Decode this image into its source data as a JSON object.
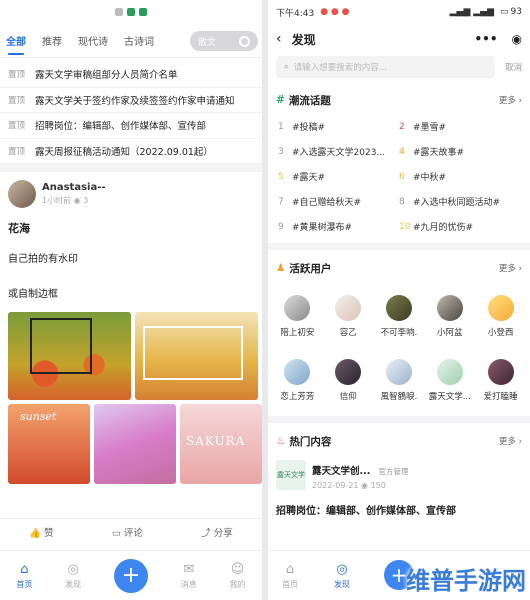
{
  "left": {
    "tabs": [
      "全部",
      "推荐",
      "现代诗",
      "古诗词",
      "散文"
    ],
    "pinned": [
      {
        "tag": "置顶",
        "text": "露天文学审稿组部分人员简介名单"
      },
      {
        "tag": "置顶",
        "text": "露天文学关于签约作家及续签签约作家申请通知"
      },
      {
        "tag": "置顶",
        "text": "招聘岗位：编辑部、创作媒体部、宣传部"
      },
      {
        "tag": "置顶",
        "text": "露天周报征稿活动通知（2022.09.01起）"
      }
    ],
    "post": {
      "author": "Anastasia--",
      "time": "1小时前",
      "views": "3",
      "title": "花海",
      "line1": "自己拍的有水印",
      "line2": "或自制边框",
      "img_text_sunset": "sunset",
      "img_text_sakura": "SAKURA"
    },
    "actions": {
      "like": "赞",
      "comment": "评论",
      "share": "分享"
    },
    "nav": {
      "home": "首页",
      "discover": "发现",
      "messages": "消息",
      "me": "我的"
    }
  },
  "right": {
    "status_time": "下午4:43",
    "status_battery": "93",
    "header_title": "发现",
    "search_placeholder": "请输入想要搜索的内容...",
    "cancel": "取消",
    "trending_title": "潮流话题",
    "more": "更多",
    "topics": [
      {
        "n": "1",
        "t": "#投稿#"
      },
      {
        "n": "2",
        "t": "#墨雪#"
      },
      {
        "n": "3",
        "t": "#入选露天文学2023..."
      },
      {
        "n": "4",
        "t": "#露天故事#"
      },
      {
        "n": "5",
        "t": "#露天#"
      },
      {
        "n": "6",
        "t": "#中秋#"
      },
      {
        "n": "7",
        "t": "#自己赠给秋天#"
      },
      {
        "n": "8",
        "t": "#入选中秋同题活动#"
      },
      {
        "n": "9",
        "t": "#黄果树瀑布#"
      },
      {
        "n": "10",
        "t": "#九月的忧伤#"
      }
    ],
    "active_title": "活跃用户",
    "users": [
      "陪上初安",
      "容乙",
      "不可李响.",
      "小阿盆",
      "小登西",
      "恋上芳芳",
      "信仰",
      "風智鶴唳.",
      "露天文学...",
      "爱打瞌睡"
    ],
    "hot_title": "热门内容",
    "hot": {
      "logo_text": "露天文学",
      "name": "露天文学创...",
      "badge": "官方管理",
      "date": "2022-09-21",
      "views": "150",
      "title": "招聘岗位：编辑部、创作媒体部、宣传部"
    },
    "nav": {
      "home": "首页",
      "discover": "发现"
    }
  },
  "watermark": "维普手游网",
  "colors": {
    "accent": "#2b6fd8",
    "hot": "#e8524a",
    "warm": "#f3a02e"
  }
}
